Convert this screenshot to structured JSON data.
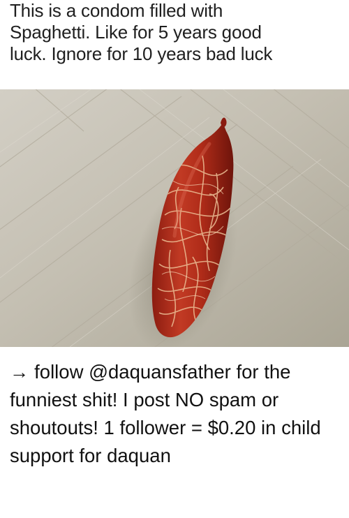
{
  "meme": {
    "caption": "This is a condom filled with\nSpaghetti. Like for 5 years good\nluck. Ignore for 10 years bad luck",
    "photo_icon": "spaghetti-sausage-photo"
  },
  "post": {
    "arrow": "→",
    "text": " follow @daquansfather for the funniest shit! I post NO spam or shoutouts! 1 follower = $0.20 in child support for daquan"
  },
  "colors": {
    "floor_light": "#c9c4b8",
    "floor_dark": "#a9a393",
    "sausage_red": "#b52d1c",
    "sausage_dark": "#7a160d",
    "noodle": "#e9b98f"
  }
}
